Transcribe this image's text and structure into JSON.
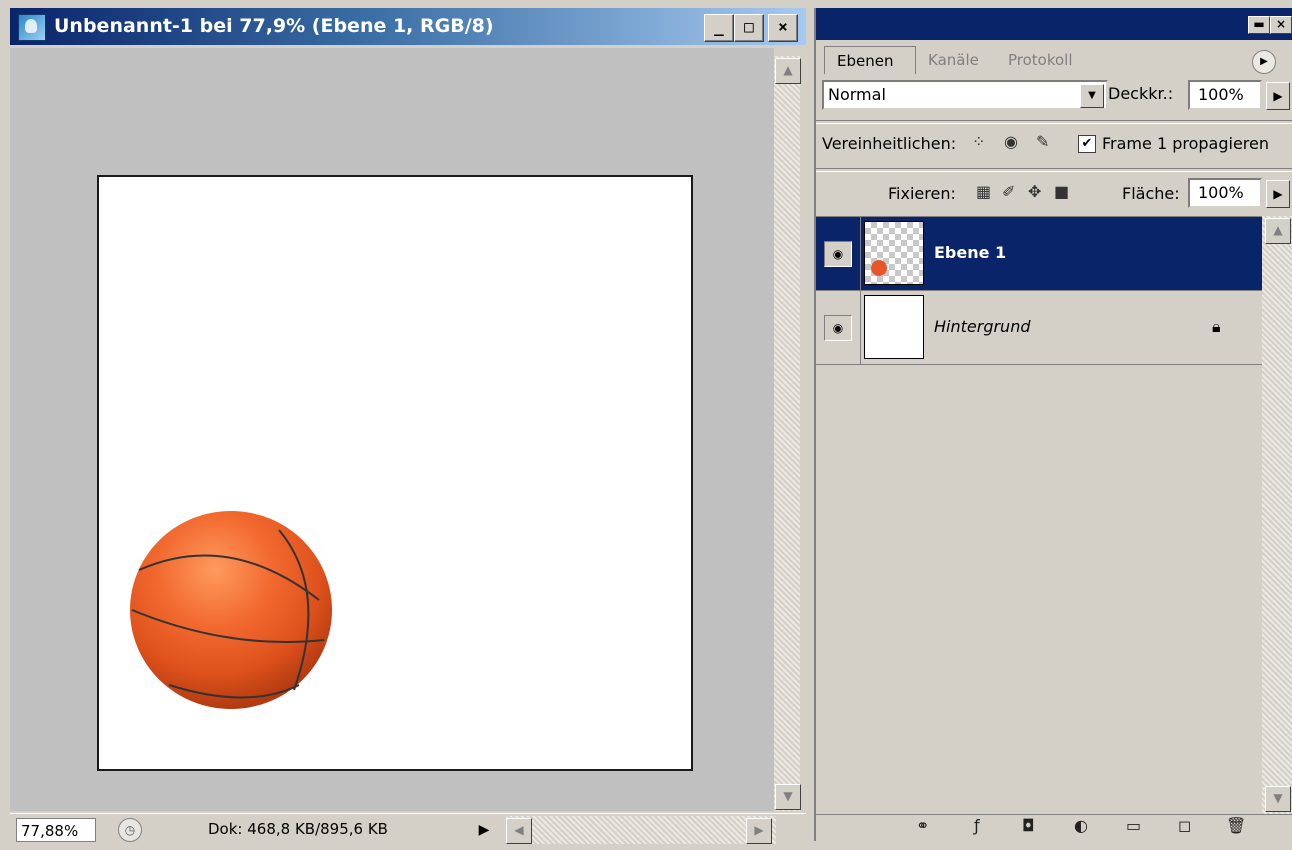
{
  "document_window": {
    "title": "Unbenannt-1 bei 77,9% (Ebene 1, RGB/8)",
    "caption_buttons": {
      "minimize": "_",
      "maximize": "□",
      "close": "×"
    },
    "status": {
      "zoom": "77,88%",
      "doc_info": "Dok: 468,8 KB/895,6 KB"
    }
  },
  "layers_palette": {
    "tabs": [
      "Ebenen",
      "Kanäle",
      "Protokoll"
    ],
    "active_tab": "Ebenen",
    "blend_mode": "Normal",
    "opacity_label": "Deckkr.:",
    "opacity_value": "100%",
    "unify_label": "Vereinheitlichen:",
    "propagate_label": "Frame 1 propagieren",
    "propagate_checked": "✔",
    "lock_label": "Fixieren:",
    "fill_label": "Fläche:",
    "fill_value": "100%",
    "layers": [
      {
        "name": "Ebene 1",
        "selected": true,
        "visible": true
      },
      {
        "name": "Hintergrund",
        "selected": false,
        "visible": true,
        "locked": true
      }
    ]
  },
  "colors": {
    "titlebar": "#0a246a",
    "selection": "#0a246a",
    "canvas_bg": "#c0c0c0",
    "ui_face": "#d4d0c8",
    "ball": "#e0521c"
  }
}
